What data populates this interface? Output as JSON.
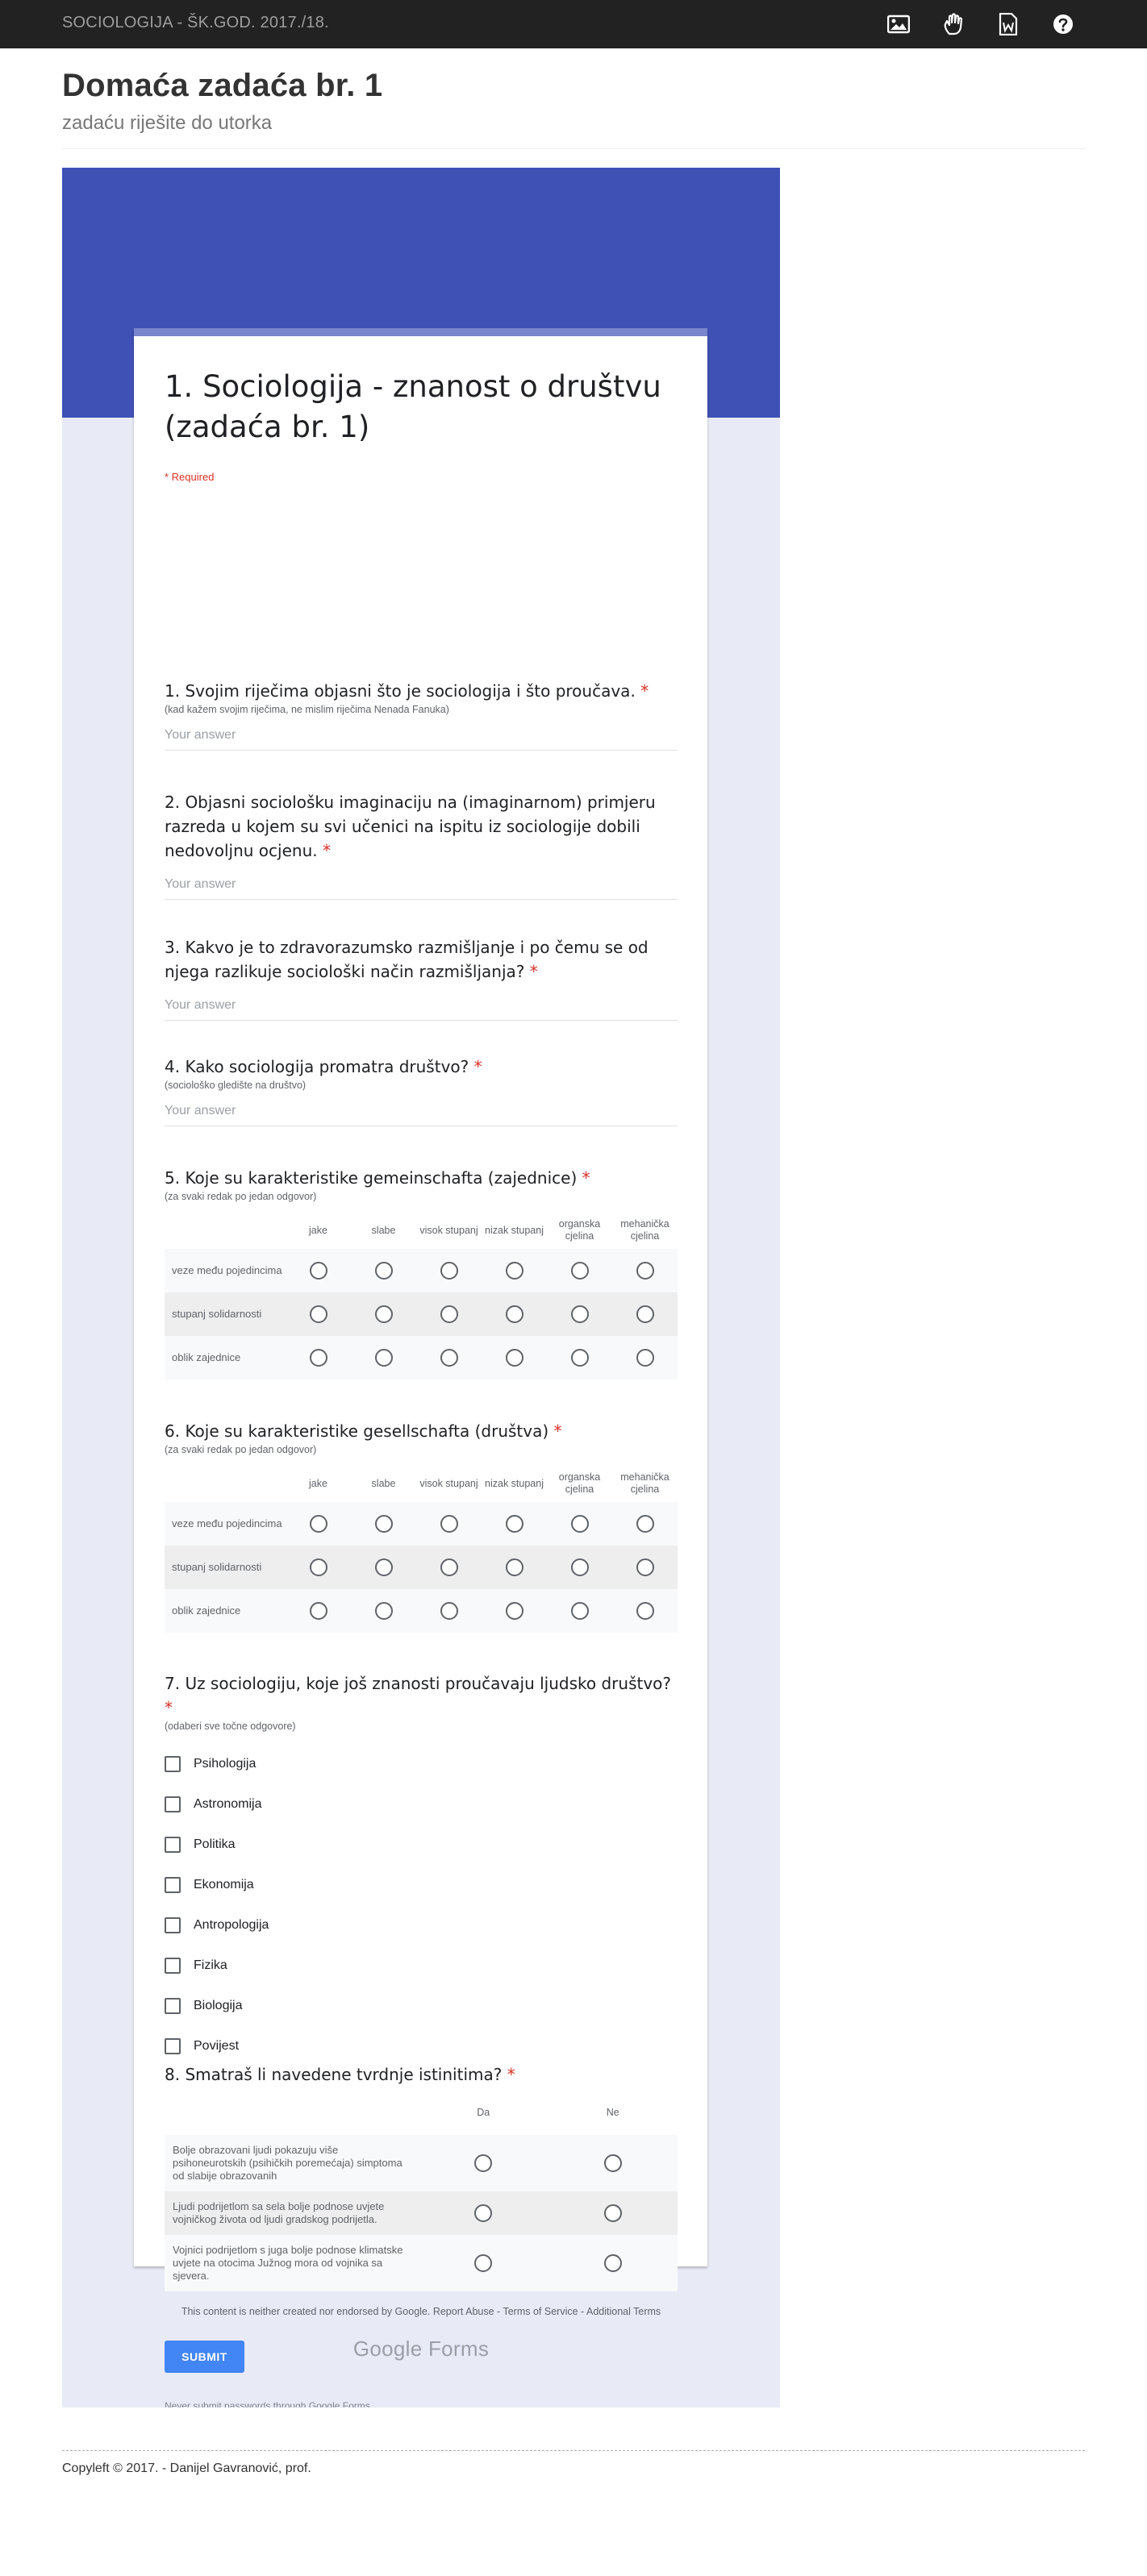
{
  "navbar": {
    "brand": "SOCIOLOGIJA - ŠK.GOD. 2017./18.",
    "icons": [
      "image-icon",
      "hand-icon",
      "word-document-icon",
      "help-icon"
    ]
  },
  "page": {
    "title": "Domaća zadaća br. 1",
    "subtitle": "zadaću riješite do utorka"
  },
  "form": {
    "title": "1. Sociologija - znanost o društvu (zadaća br. 1)",
    "required_note": "* Required",
    "answer_placeholder": "Your answer",
    "questions": {
      "q1": {
        "title": "1. Svojim riječima objasni što je sociologija i što proučava.",
        "help": "(kad kažem svojim riječima, ne mislim riječima Nenada Fanuka)"
      },
      "q2": {
        "title": "2. Objasni sociološku imaginaciju na (imaginarnom) primjeru razreda u kojem su svi učenici na ispitu iz sociologije dobili nedovoljnu ocjenu."
      },
      "q3": {
        "title": "3. Kakvo je to zdravorazumsko razmišljanje i po čemu se od njega razlikuje sociološki način razmišljanja?"
      },
      "q4": {
        "title": "4. Kako sociologija promatra društvo?",
        "help": "(sociološko gledište na društvo)"
      },
      "q5": {
        "title": "5. Koje su karakteristike gemeinschafta (zajednice)",
        "help": "(za svaki redak po jedan odgovor)",
        "columns": [
          "jake",
          "slabe",
          "visok stupanj",
          "nizak stupanj",
          "organska cjelina",
          "mehanička cjelina"
        ],
        "rows": [
          "veze među pojedincima",
          "stupanj solidarnosti",
          "oblik zajednice"
        ]
      },
      "q6": {
        "title": "6. Koje su karakteristike gesellschafta (društva)",
        "help": "(za svaki redak po jedan odgovor)",
        "columns": [
          "jake",
          "slabe",
          "visok stupanj",
          "nizak stupanj",
          "organska cjelina",
          "mehanička cjelina"
        ],
        "rows": [
          "veze među pojedincima",
          "stupanj solidarnosti",
          "oblik zajednice"
        ]
      },
      "q7": {
        "title": "7. Uz sociologiju, koje još znanosti proučavaju ljudsko društvo?",
        "help": "(odaberi sve točne odgovore)",
        "options": [
          "Psihologija",
          "Astronomija",
          "Politika",
          "Ekonomija",
          "Antropologija",
          "Fizika",
          "Biologija",
          "Povijest"
        ]
      },
      "q8": {
        "title": "8. Smatraš li navedene tvrdnje istinitima?",
        "columns": [
          "Da",
          "Ne"
        ],
        "rows": [
          "Bolje obrazovani ljudi pokazuju više psihoneurotskih (psihičkih poremećaja) simptoma od slabije obrazovanih",
          "Ljudi podrijetlom sa sela bolje podnose uvjete vojničkog života od ljudi gradskog podrijetla.",
          "Vojnici podrijetlom s juga bolje podnose klimatske uvjete na otocima Južnog mora od vojnika sa sjevera."
        ]
      }
    },
    "submit_label": "SUBMIT",
    "password_warning": "Never submit passwords through Google Forms."
  },
  "disclaimer": {
    "text": "This content is neither created nor endorsed by Google.",
    "report_abuse": "Report Abuse",
    "terms": "Terms of Service",
    "additional": "Additional Terms"
  },
  "brand_logo": "Google Forms",
  "footer": {
    "copyright": "Copyleft © 2017. - Danijel Gavranović, prof."
  },
  "colors": {
    "navbar": "#222222",
    "banner": "#3f51b5",
    "card_accent": "#7986cb",
    "form_background": "#e8eaf6",
    "submit": "#4285f4",
    "required": "#d93025"
  }
}
